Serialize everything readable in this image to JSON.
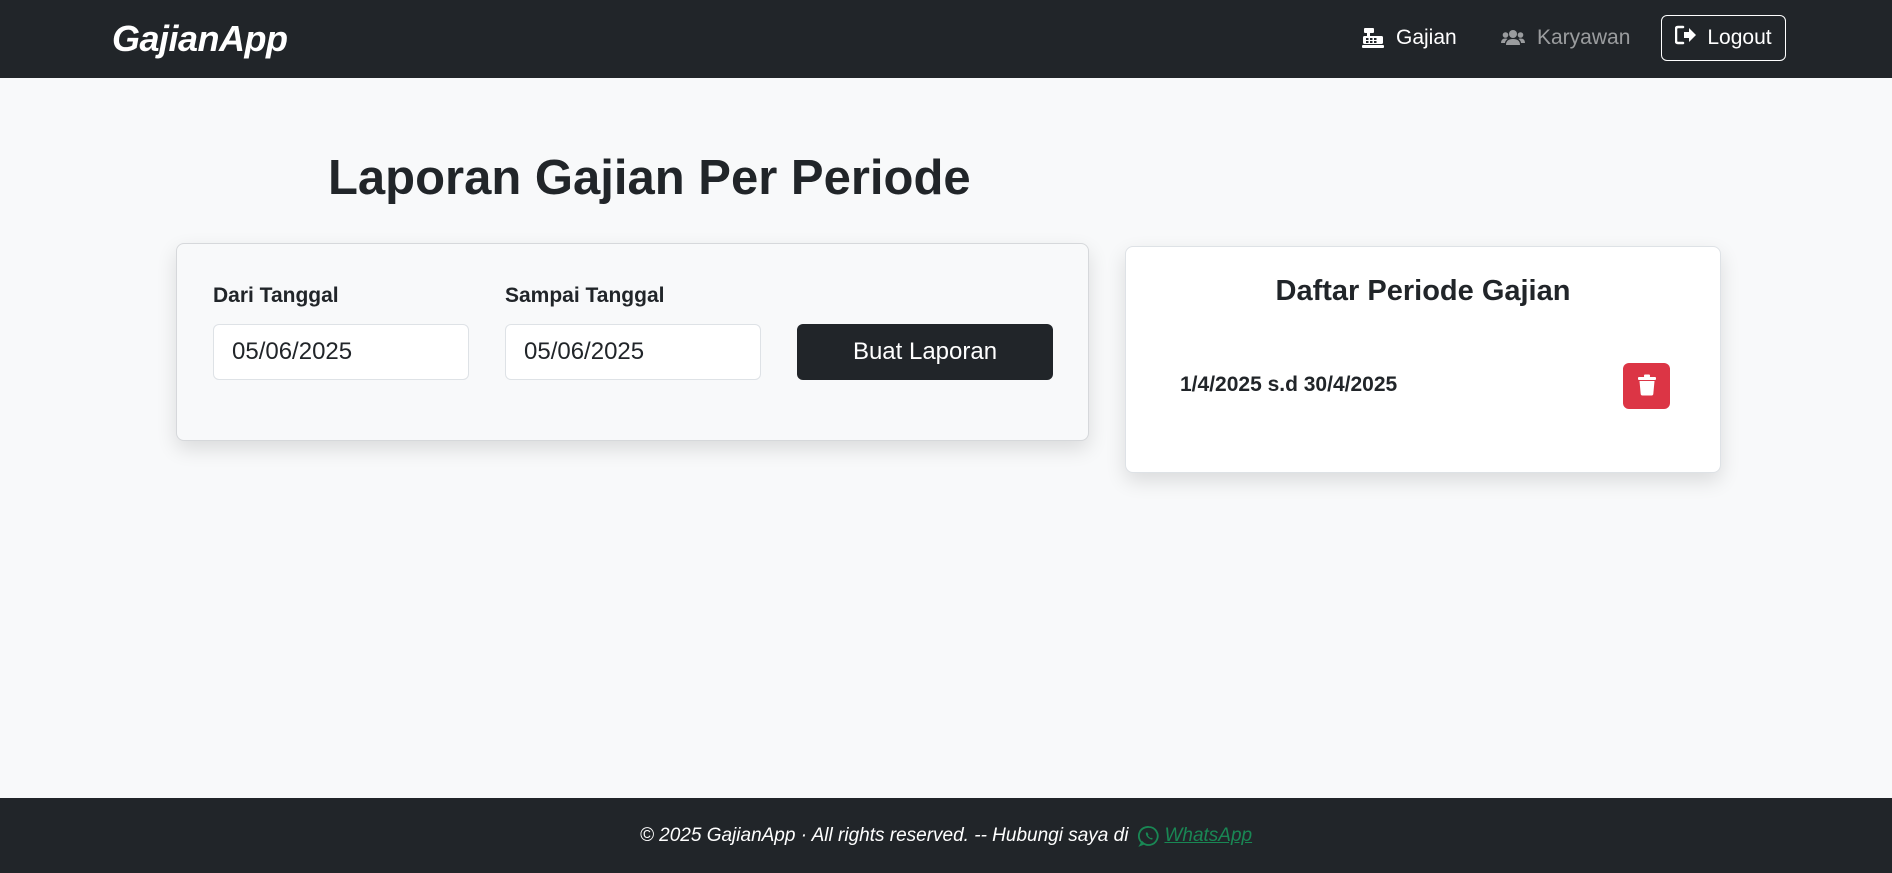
{
  "navbar": {
    "brand": "GajianApp",
    "items": [
      {
        "label": "Gajian",
        "icon": "cash-register-icon",
        "active": true
      },
      {
        "label": "Karyawan",
        "icon": "users-icon",
        "active": false
      }
    ],
    "logout_label": "Logout",
    "logout_icon": "sign-out-icon"
  },
  "main": {
    "title": "Laporan Gajian Per Periode",
    "form": {
      "from_label": "Dari Tanggal",
      "from_value": "05/06/2025",
      "to_label": "Sampai Tanggal",
      "to_value": "05/06/2025",
      "submit_label": "Buat Laporan"
    },
    "periods": {
      "title": "Daftar Periode Gajian",
      "items": [
        {
          "label": "1/4/2025 s.d 30/4/2025",
          "delete_icon": "trash-icon"
        }
      ]
    }
  },
  "footer": {
    "text": "© 2025 GajianApp · All rights reserved. -- Hubungi saya di",
    "link_label": "WhatsApp",
    "link_icon": "whatsapp-icon"
  },
  "colors": {
    "dark": "#212529",
    "background": "#f8f9fa",
    "danger": "#dc3545",
    "success": "#198754",
    "muted_nav": "rgba(255,255,255,0.55)"
  }
}
